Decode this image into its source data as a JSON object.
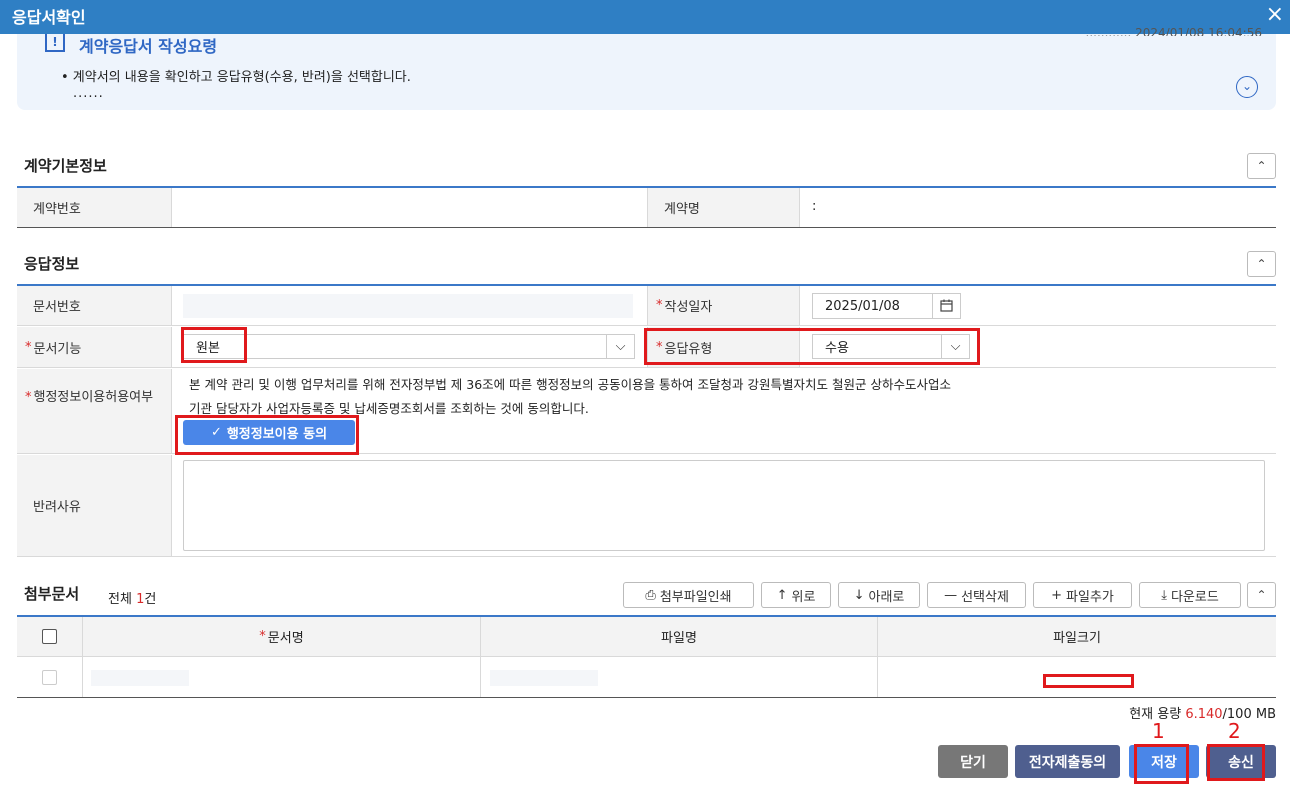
{
  "window": {
    "title": "응답서확인",
    "close_icon": "×"
  },
  "guide": {
    "title": "계약응답서 작성요령",
    "icon": "!",
    "meta": "............ 2024/01/08 16:04:56",
    "bullet": "• 계약서의 내용을 확인하고 응답유형(수용, 반려)을 선택합니다.",
    "dots": "......",
    "expand_icon": "⌄"
  },
  "contract": {
    "section_title": "계약기본정보",
    "collapse_icon": "⌃",
    "number_label": "계약번호",
    "number_value": "",
    "name_label": "계약명",
    "name_value": ":"
  },
  "response": {
    "section_title": "응답정보",
    "collapse_icon": "⌃",
    "docno_label": "문서번호",
    "date_label": "작성일자",
    "date_value": "2025/01/08",
    "func_label": "문서기능",
    "func_value": "원본",
    "type_label": "응답유형",
    "type_value": "수용",
    "consent_label": "행정정보이용허용여부",
    "consent_text1": "본 계약 관리 및 이행 업무처리를 위해 전자정부법 제 36조에 따른 행정정보의 공동이용을 통하여 조달청과 강원특별자치도 철원군 상하수도사업소",
    "consent_text2": "기관 담당자가 사업자등록증 및 납세증명조회서를 조회하는 것에 동의합니다.",
    "consent_button": "행정정보이용 동의",
    "reject_label": "반려사유",
    "required_mark": "*"
  },
  "attachments": {
    "section_title": "첨부문서",
    "total_prefix": "전체 ",
    "total_count": "1",
    "total_suffix": "건",
    "buttons": {
      "print": "첨부파일인쇄",
      "up": "위로",
      "down": "아래로",
      "delete": "선택삭제",
      "add": "파일추가",
      "download": "다운로드"
    },
    "columns": [
      "문서명",
      "파일명",
      "파일크기"
    ],
    "required_mark": "*"
  },
  "capacity": {
    "label": "현재 용량",
    "used": "6.140",
    "total": "/100 MB"
  },
  "footer": {
    "close": "닫기",
    "consent": "전자제출동의",
    "save": "저장",
    "send": "송신",
    "mark1": "1",
    "mark2": "2"
  },
  "colors": {
    "accent": "#2f7fc4",
    "primary_button": "#4a86e8",
    "dark_button": "#4f5f8f",
    "gray_button": "#777777",
    "highlight": "#e0191c"
  }
}
